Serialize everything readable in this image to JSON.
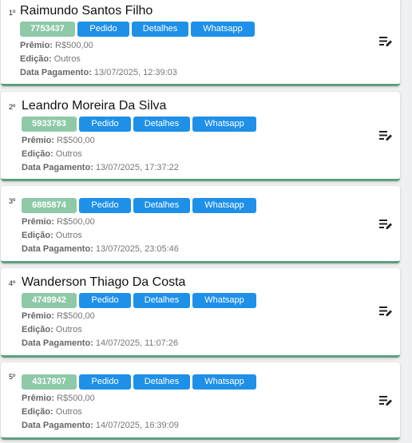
{
  "labels": {
    "premio": "Prêmio:",
    "edicao": "Edição:",
    "data_pagamento": "Data Pagamento:",
    "pedido": "Pedido",
    "detalhes": "Detalhes",
    "whatsapp": "Whatsapp"
  },
  "icons": {
    "edit": "edit-list-icon"
  },
  "colors": {
    "code_badge": "#8ec9a8",
    "button": "#1e90e8",
    "card_border": "#5f9e7f"
  },
  "winners": [
    {
      "rank": "1º",
      "name": "Raimundo Santos Filho",
      "code": "7753437",
      "premio": "R$500,00",
      "edicao": "Outros",
      "data_pagamento": "13/07/2025, 12:39:03"
    },
    {
      "rank": "2º",
      "name": "Leandro Moreira Da Silva",
      "code": "5933783",
      "premio": "R$500,00",
      "edicao": "Outros",
      "data_pagamento": "13/07/2025, 17:37:22"
    },
    {
      "rank": "3º",
      "name": "",
      "code": "6885874",
      "premio": "R$500,00",
      "edicao": "Outros",
      "data_pagamento": "13/07/2025, 23:05:46"
    },
    {
      "rank": "4º",
      "name": "Wanderson Thiago Da Costa",
      "code": "4749942",
      "premio": "R$500,00",
      "edicao": "Outros",
      "data_pagamento": "14/07/2025, 11:07:26"
    },
    {
      "rank": "5º",
      "name": "",
      "code": "4317807",
      "premio": "R$500,00",
      "edicao": "Outros",
      "data_pagamento": "14/07/2025, 16:39:09"
    }
  ]
}
